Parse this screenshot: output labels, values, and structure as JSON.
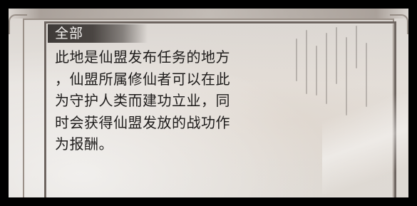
{
  "tag": {
    "label": "全部"
  },
  "description": {
    "lines": [
      "此地是仙盟发布任务的地方",
      "，仙盟所属修仙者可以在此",
      "为守护人类而建功立业，同",
      "时会获得仙盟发放的战功作",
      "为报酬。"
    ]
  }
}
